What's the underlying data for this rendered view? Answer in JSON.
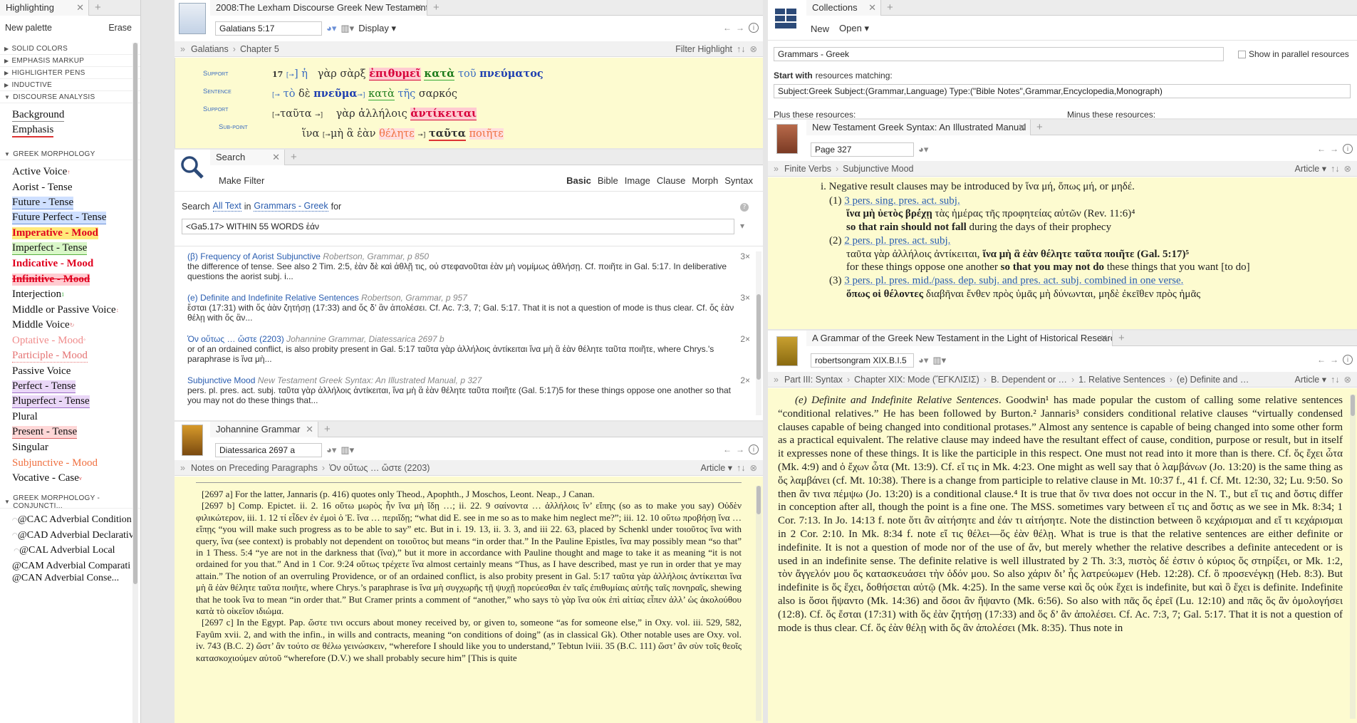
{
  "highlighting": {
    "tab": "Highlighting",
    "new_palette": "New palette",
    "erase": "Erase",
    "sections": [
      "SOLID COLORS",
      "EMPHASIS MARKUP",
      "HIGHLIGHTER PENS",
      "INDUCTIVE",
      "DISCOURSE ANALYSIS"
    ],
    "discourse_items": [
      "Background",
      "Emphasis"
    ],
    "morph_header": "GREEK MORPHOLOGY",
    "morph_items": [
      "Active Voice",
      "Aorist - Tense",
      "Future - Tense",
      "Future Perfect - Tense",
      "Imperative - Mood",
      "Imperfect - Tense",
      "Indicative - Mood",
      "Infinitive - Mood",
      "Interjection",
      "Middle or Passive Voice",
      "Middle Voice",
      "Optative - Mood",
      "Participle - Mood",
      "Passive Voice",
      "Perfect - Tense",
      "Pluperfect - Tense",
      "Plural",
      "Present - Tense",
      "Singular",
      "Subjunctive - Mood",
      "Vocative - Case"
    ],
    "conj_header": "GREEK MORPHOLOGY - CONJUNCTI...",
    "conj_items": [
      "@CAC Adverbial Condition",
      "@CAD Adverbial Declarative",
      "@CAL Adverbial Local",
      "@CAM Adverbial Comparati",
      "@CAN Adverbial Conse..."
    ]
  },
  "lexham": {
    "tab": "2008:The Lexham Discourse Greek New Testament",
    "reference": "Galatians 5:17",
    "display": "Display",
    "path": [
      "Galatians",
      "Chapter 5"
    ],
    "filter": "Filter Highlight",
    "lines": [
      {
        "label": "Support",
        "verse": "17",
        "parts": [
          "[",
          "→",
          "] ἡ",
          "  γὰρ σὰρξ ",
          "ἐπιθυμεῖ",
          " ",
          "κατὰ",
          " ",
          "τοῦ",
          " ",
          "πνεύματος"
        ]
      },
      {
        "label": "Sentence",
        "text": "[→ τὸ δὲ πνεῦμα ] κατὰ τῆς σαρκός"
      },
      {
        "label": "Support",
        "text": "[→ταῦτα →]  γὰρ ἀλλήλοις ἀντίκειται"
      },
      {
        "label": "Sub-point",
        "text": "ἵνα [→μὴ ἃ ἐὰν θέλητε →] ταῦτα ποιῆτε"
      }
    ]
  },
  "search": {
    "tab": "Search",
    "make_filter": "Make Filter",
    "kinds": [
      "Basic",
      "Bible",
      "Image",
      "Clause",
      "Morph",
      "Syntax"
    ],
    "scope_prefix": "Search",
    "scope_all": "All Text",
    "scope_in": "in",
    "scope_coll": "Grammars - Greek",
    "scope_for": "for",
    "query": "<Ga5.17> WITHIN 55 WORDS ἐάν",
    "results": [
      {
        "title": "(β) Frequency of Aorist Subjunctive",
        "source": "Robertson, Grammar, p 850",
        "count": "3×",
        "text": "the difference of tense. See also 2 Tim. 2:5, ἐὰν δὲ καὶ ἀθλῇ τις, οὐ στεφανοῦται ἐὰν μὴ νομίμως ἀθλήσῃ. Cf. ποιῆτε in Gal. 5:17. In deliberative questions the aorist subj. i..."
      },
      {
        "title": "(e) Definite and Indefinite Relative Sentences",
        "source": "Robertson, Grammar, p 957",
        "count": "3×",
        "text": "ἔσται (17:31) with ὅς ἀὰν ζητήσῃ (17:33) and ὅς δ’ ἂν ἀπολέσει. Cf. Ac. 7:3, 7; Gal. 5:17. That it is not a question of mode is thus clear. Cf. ὅς ἐὰν θέλῃ with ὅς ἂν..."
      },
      {
        "title": "Ὁν οὕτως … ὥστε (2203)",
        "source": "Johannine Grammar, Diatessarica 2697 b",
        "count": "2×",
        "text": "or of an ordained conflict, is also probity present in Gal. 5:17 ταῦτα γὰρ ἀλλήλοις ἀντίκειται ἵνα μὴ ἃ ἐὰν θέλητε ταῦτα ποιῆτε, where Chrys.'s paraphrase is ἵνα μὴ..."
      },
      {
        "title": "Subjunctive Mood",
        "source": "New Testament Greek Syntax: An Illustrated Manual, p 327",
        "count": "2×",
        "text": "pers. pl. pres. act. subj. ταῦτα γὰρ ἀλλήλοις ἀντίκειται, ἵνα μὴ ἃ ἐὰν θέλητε ταῦτα ποιῆτε (Gal. 5:17)5 for these things oppose one another so that you may not do these things that..."
      }
    ]
  },
  "johannine": {
    "tab": "Johannine Grammar",
    "reference": "Diatessarica 2697 a",
    "path": [
      "Notes on Preceding Paragraphs",
      "Ὁν οὕτως … ὥστε (2203)"
    ],
    "article": "Article",
    "paras": [
      "[2697 a] For the latter, Jannaris (p. 416) quotes only Theod., Apophth., J Moschos, Leont. Neap., J Canan.",
      "[2697 b] Comp. Epictet. ii. 2. 16 οὕτω μωρὸς ἦν ἵνα μὴ ἴδῃ …; ii. 22. 9 σαίνοντα … ἀλλήλοις ἵν’ εἴπης (so as to make you say) Οὐδὲν φιλικώτερον, iii. 1. 12 τί εἶδεν ἐν ἐμοὶ ὁ Ἐ. ἵνα … περιἴδῃ; “what did E. see in me so as to make him neglect me?”; iii. 12. 10 οὕτω προβήσῃ ἵνα … εἴπῃς “you will make such progress as to be able to say” etc. But in i. 19. 13, ii. 3. 3, and iii 22. 63, placed by Schenkl under τοιοῦτος ἵνα with query, ἵνα (see context) is probably not dependent on τοιοῦτος but means “in order that.” In the Pauline Epistles, ἵνα may possibly mean “so that” in 1 Thess. 5:4 “ye are not in the darkness that (ἵνα),” but it more in accordance with Pauline thought and mage to take it as meaning “it is not ordained for you that.” And in 1 Cor. 9:24 οὕτως τρέχετε ἵνα almost certainly means “Thus, as I have described, mast ye run in order that ye may attain.” The notion of an overruling Providence, or of an ordained conflict, is also probity present in Gal. 5:17 ταῦτα γὰρ ἀλλήλοις ἀντίκειται ἵνα μὴ ἃ ἐὰν θέλητε ταῦτα ποιῆτε, where Chrys.’s paraphrase is ἵνα μὴ συγχωρῆς τῇ ψυχῇ πορεύεσθαι ἐν ταῖς ἐπιθυμίαις αὐτῆς ταῖς πονηραῖς, shewing that he took ἵνα to mean “in order that.” But Cramer prints a comment of “another,” who says τὸ γὰρ ἵνα οὐκ ἐπὶ αἰτίας εἶπεν ἀλλ’ ὡς ἀκολούθου κατὰ τὸ οἰκεῖον ιδιώμα.",
      "[2697 c] In the Egypt. Pap. ὥστε τινι occurs about money received by, or given to, someone “as for someone else,” in Oxy. vol. iii. 529, 582, Fayûm xvii. 2, and with the infin., in wills and contracts, meaning “on conditions of doing” (as in classical Gk). Other notable uses are Oxy. vol. iv. 743 (B.C. 2) ὥστ’ ἂν τούτο σε θέλω γεινώσκειν, “wherefore I should like you to understand,” Tebtun lviii. 35 (B.C. 111) ὥστ’ ἂν σὺν τοῖς θεοῖς κατασκοχιούμεν αὐτοῦ “wherefore (D.V.) we shall probably secure him” [This is quite"
    ]
  },
  "collections": {
    "tab": "Collections",
    "new": "New",
    "open": "Open",
    "name": "Grammars - Greek",
    "parallel": "Show in parallel resources",
    "start_with": "Start with",
    "resources_matching": "resources matching:",
    "rule": "Subject:Greek Subject:(Grammar,Language) Type:(\"Bible Notes\",Grammar,Encyclopedia,Monograph)",
    "plus": "Plus these resources:",
    "minus": "Minus these resources:"
  },
  "ntsyntax": {
    "tab": "New Testament Greek Syntax: An Illustrated Manual",
    "page": "Page 327",
    "path": [
      "Finite Verbs",
      "Subjunctive Mood"
    ],
    "article": "Article",
    "intro": "i.  Negative result clauses may be introduced by ἵνα μή, ὅπως μή, or μηδέ.",
    "items": [
      {
        "num": "(1)",
        "head": "3 pers. sing. pres. act. subj.",
        "greek": "ἵνα μὴ ὑετὸς βρέχῃ",
        "greek_rest": " τὰς ἡμέρας τῆς προφητείας αὐτῶν (Rev. 11:6)⁴",
        "eng_bold": "so that rain should not fall",
        "eng_rest": " during the days of their prophecy"
      },
      {
        "num": "(2)",
        "head": "2 pers. pl. pres. act. subj.",
        "greek": "ταῦτα γὰρ ἀλλήλοις ἀντίκειται, ",
        "greek_rest": "ἵνα μὴ ἃ ἐὰν θέλητε ταῦτα ποιῆτε (Gal. 5:17)⁵",
        "eng_bold": "so that you may not do",
        "eng_pre": "for these things oppose one another ",
        "eng_rest": " these things that you want [to do]"
      },
      {
        "num": "(3)",
        "head": "3 pers. pl. pres. mid./pass. dep. subj. and pres. act. subj. combined in one verse.",
        "greek": "ὅπως οἱ θέλοντες",
        "greek_rest": " διαβῆναι ἔνθεν πρὸς ὑμᾶς μὴ δύνωνται, μηδὲ ἐκεῖθεν πρὸς ἡμᾶς"
      }
    ]
  },
  "robertson": {
    "tab": "A Grammar of the Greek New Testament in the Light of Historical Research",
    "reference": "robertsongram XIX.B.I.5",
    "path": [
      "Part III: Syntax",
      "Chapter XIX: Mode (ἜΓΚΛΙΣΙΣ)",
      "B. Dependent or …",
      "1. Relative Sentences",
      "(e) Definite and …"
    ],
    "article": "Article",
    "heading": "(e) Definite and Indefinite Relative Sentences",
    "body": ". Goodwin¹ has made popular the custom of calling some relative sentences “conditional relatives.” He has been followed by Burton.² Jannaris³ considers conditional relative clauses “virtually condensed clauses capable of being changed into conditional protases.” Almost any sentence is capable of being changed into some other form as a practical equivalent. The relative clause may indeed have the resultant effect of cause, condition, purpose or result, but in itself it expresses none of these things. It is like the participle in this respect. One must not read into it more than is there. Cf. ὅς ἔχει ὦτα (Mk. 4:9) and ὁ ἔχων ὦτα (Mt. 13:9). Cf. εἴ τις in Mk. 4:23. One might as well say that ὁ λαμβάνων (Jo. 13:20) is the same thing as ὅς λαμβάνει (cf. Mt. 10:38). There is a change from participle to relative clause in Mt. 10:37 f., 41 f. Cf. Mt. 12:30, 32; Lu. 9:50. So then ἂν τινα πέμψω (Jo. 13:20) is a conditional clause.⁴ It is true that ὅν τινα does not occur in the N. T., but εἴ τις and ὅστις differ in conception after all, though the point is a fine one. The MSS. sometimes vary between εἴ τις and ὅστις as we see in Mk. 8:34; 1 Cor. 7:13. In Jo. 14:13 f. note ὅτι ἂν αἰτήσητε and ἐάν τι αἰτήσητε. Note the distinction between ὃ κεχάρισμαι and εἴ τι κεχάρισμαι in 2 Cor. 2:10. In Mk. 8:34 f. note εἴ τις θέλει—ὅς ἐὰν θέλῃ. What is true is that the relative sentences are either definite or indefinite. It is not a question of mode nor of the use of ἄν, but merely whether the relative describes a definite antecedent or is used in an indefinite sense. The definite relative is well illustrated by 2 Th. 3:3, πιστὸς δέ ἐστιν ὁ κύριος ὅς στηρίξει, or Mk. 1:2, τὸν ἄγγελόν μου ὅς κατασκευάσει τὴν ὁδόν μου. So also χάριν δι’ ἧς λατρεύωμεν (Heb. 12:28). Cf. ὃ προσενέγκῃ (Heb. 8:3). But indefinite is ὅς ἔχει, δοθήσεται αὐτῷ (Mk. 4:25). In the same verse καὶ ὅς οὐκ ἔχει is indefinite, but καὶ ὃ ἔχει is definite. Indefinite also is ὅσοι ἥψαντο (Mk. 14:36) and ὅσοι ἂν ἥψαντο (Mk. 6:56). So also with πᾶς ὅς ἐρεῖ (Lu. 12:10) and πᾶς ὅς ἂν ὁμολογήσει (12:8). Cf. ὅς ἔσται (17:31) with ὅς ἐὰν ζητήσῃ (17:33) and ὅς δ’ ἂν ἀπολέσει. Cf. Ac. 7:3, 7; Gal. 5:17. That it is not a question of mode is thus clear. Cf. ὅς ἐὰν θέλῃ with ὅς ἂν ἀπολέσει (Mk. 8:35). Thus note in"
  },
  "colors": {
    "yellow": "#fdfbd0",
    "link": "#2a5db0",
    "red": "#e0001e"
  }
}
